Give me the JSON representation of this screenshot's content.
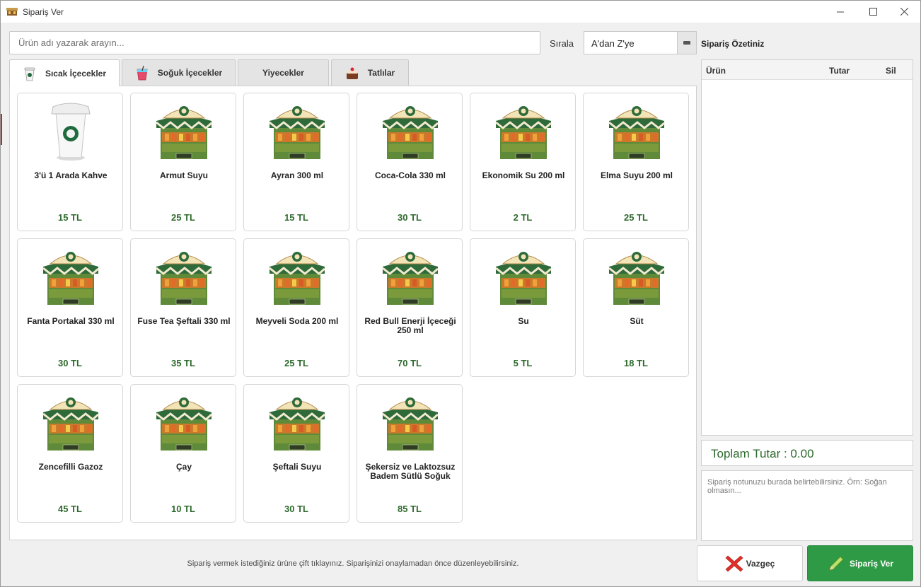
{
  "window": {
    "title": "Sipariş Ver",
    "minimize_icon": "minimize-icon",
    "maximize_icon": "maximize-icon",
    "close_icon": "close-icon"
  },
  "search": {
    "placeholder": "Ürün adı yazarak arayın...",
    "value": ""
  },
  "sort": {
    "label": "Sırala",
    "selected": "A'dan Z'ye"
  },
  "tabs": [
    {
      "label": "Sıcak İçecekler",
      "icon": "coffee-cup-icon",
      "active": true
    },
    {
      "label": "Soğuk İçecekler",
      "icon": "cold-drink-icon",
      "active": false
    },
    {
      "label": "Yiyecekler",
      "icon": "",
      "active": false
    },
    {
      "label": "Tatlılar",
      "icon": "cake-icon",
      "active": false
    }
  ],
  "products": [
    {
      "name": "3'ü 1 Arada Kahve",
      "price": "15 TL",
      "image": "coffee-cup-image"
    },
    {
      "name": "Armut Suyu",
      "price": "25 TL",
      "image": "market-stall-image"
    },
    {
      "name": "Ayran 300 ml",
      "price": "15 TL",
      "image": "market-stall-image"
    },
    {
      "name": "Coca-Cola 330 ml",
      "price": "30 TL",
      "image": "market-stall-image"
    },
    {
      "name": "Ekonomik Su 200 ml",
      "price": "2 TL",
      "image": "market-stall-image"
    },
    {
      "name": "Elma Suyu 200 ml",
      "price": "25 TL",
      "image": "market-stall-image"
    },
    {
      "name": "Fanta Portakal 330 ml",
      "price": "30 TL",
      "image": "market-stall-image"
    },
    {
      "name": "Fuse Tea Şeftali 330 ml",
      "price": "35 TL",
      "image": "market-stall-image"
    },
    {
      "name": "Meyveli Soda 200 ml",
      "price": "25 TL",
      "image": "market-stall-image"
    },
    {
      "name": "Red Bull Enerji İçeceği 250 ml",
      "price": "70 TL",
      "image": "market-stall-image"
    },
    {
      "name": "Su",
      "price": "5 TL",
      "image": "market-stall-image"
    },
    {
      "name": "Süt",
      "price": "18 TL",
      "image": "market-stall-image"
    },
    {
      "name": "Zencefilli Gazoz",
      "price": "45 TL",
      "image": "market-stall-image"
    },
    {
      "name": "Çay",
      "price": "10 TL",
      "image": "market-stall-image"
    },
    {
      "name": "Şeftali Suyu",
      "price": "30 TL",
      "image": "market-stall-image"
    },
    {
      "name": "Şekersiz ve Laktozsuz Badem Sütlü Soğuk",
      "price": "85 TL",
      "image": "market-stall-image"
    }
  ],
  "hint": "Sipariş vermek istediğiniz ürüne çift tıklayınız. Siparişinizi onaylamadan önce düzenleyebilirsiniz.",
  "summary": {
    "title": "Sipariş Özetiniz",
    "columns": [
      "Ürün",
      "Tutar",
      "Sil"
    ],
    "rows": [],
    "total_label": "Toplam Tutar : 0.00",
    "note_placeholder": "Sipariş notunuzu burada belirtebilirsiniz. Örn: Soğan olmasın..."
  },
  "buttons": {
    "cancel": "Vazgeç",
    "cancel_icon": "red-x-icon",
    "order": "Sipariş Ver",
    "order_icon": "pencil-icon"
  },
  "colors": {
    "price_green": "#2d6a2d",
    "order_button": "#2f9a46",
    "cancel_icon_red": "#e0302a"
  }
}
